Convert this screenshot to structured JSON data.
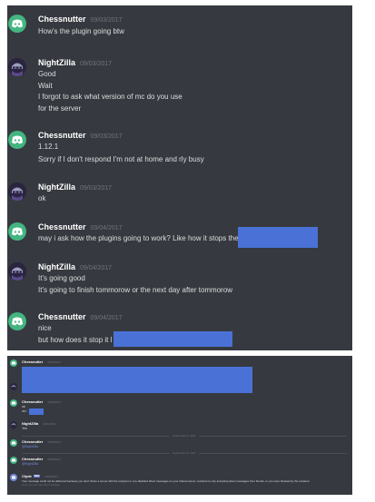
{
  "top_messages": [
    {
      "author": "Chessnutter",
      "avatar": "discord-logo",
      "timestamp": "09/03/2017",
      "lines": [
        "How's the plugin going btw"
      ]
    },
    {
      "author": "NightZilla",
      "avatar": "ninja-avatar",
      "timestamp": "09/03/2017",
      "lines": [
        "Good",
        "Wait",
        "I forgot to ask what version of mc do you use",
        "for the server"
      ]
    },
    {
      "author": "Chessnutter",
      "avatar": "discord-logo",
      "timestamp": "09/03/2017",
      "lines": [
        "1.12.1",
        "Sorry if I don't respond I'm not at home and rly busy"
      ]
    },
    {
      "author": "NightZilla",
      "avatar": "ninja-avatar",
      "timestamp": "09/03/2017",
      "lines": [
        "ok"
      ]
    },
    {
      "author": "Chessnutter",
      "avatar": "discord-logo",
      "timestamp": "09/04/2017",
      "lines": [
        "may i ask how the plugins going to work? Like how it stops the i"
      ]
    },
    {
      "author": "NightZilla",
      "avatar": "ninja-avatar",
      "timestamp": "09/04/2017",
      "lines": [
        "It's going good",
        "It's going to finish tommorow or the next day after tommorow"
      ]
    },
    {
      "author": "Chessnutter",
      "avatar": "discord-logo",
      "timestamp": "09/04/2017",
      "lines": [
        "nice",
        "but how does it stop it l"
      ]
    }
  ],
  "bottom": {
    "chess1": {
      "author": "Chessnutter",
      "timestamp": "09/04/2017"
    },
    "chess2": {
      "author": "Chessnutter",
      "timestamp": "09/04/2017",
      "lines": [
        "ok",
        "ok i"
      ]
    },
    "night": {
      "author": "NightZilla",
      "timestamp": "09/04/2017",
      "lines": [
        "Yes"
      ]
    },
    "divider1": "September 6, 2017",
    "chess3": {
      "author": "Chessnutter",
      "timestamp": "09/06/2017",
      "lines": [
        "@NightZilla"
      ]
    },
    "divider2": "September 8, 2017",
    "chess4": {
      "author": "Chessnutter",
      "timestamp": "09/08/2017",
      "lines": [
        "@NightZilla"
      ]
    },
    "clyde": {
      "author": "Clyde",
      "badge": "BOT",
      "timestamp": "09/08/2017",
      "lines": [
        "Your message could not be delivered because you don't share a server with the recipient or you disabled direct messages on your shared server, recipient is only accepting direct messages from friends, or you were blocked by the recipient.",
        "Only you can see this message"
      ]
    }
  },
  "colors": {
    "background": "#36393f",
    "redaction": "#4a72d6",
    "discord_green": "#43b581"
  }
}
